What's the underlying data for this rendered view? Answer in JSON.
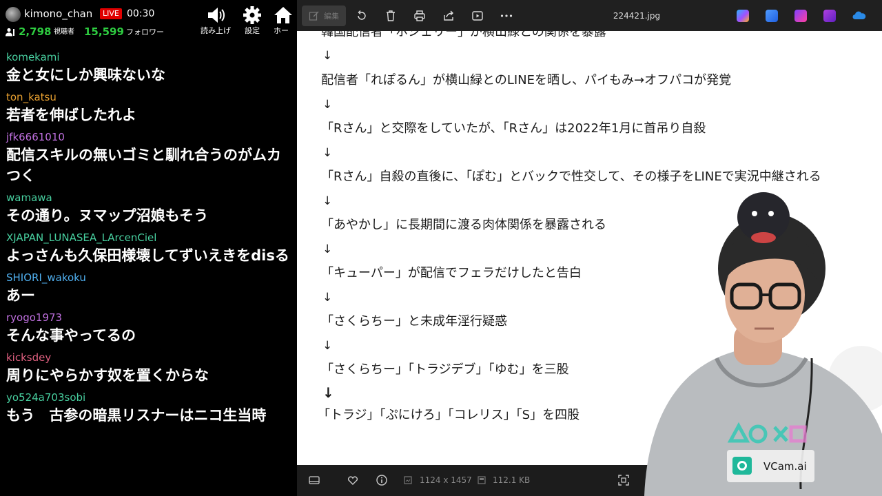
{
  "stream": {
    "username": "kimono_chan",
    "live_label": "LIVE",
    "elapsed": "00:30",
    "viewers": "2,798",
    "viewers_label": "視聴者",
    "followers": "15,599",
    "followers_label": "フォロワー",
    "buttons": [
      {
        "label": "読み上げ",
        "icon": "speaker-icon"
      },
      {
        "label": "設定",
        "icon": "gear-icon"
      },
      {
        "label": "ホー",
        "icon": "home-icon"
      }
    ]
  },
  "chat": [
    {
      "user": "komekami",
      "color": "#48d0a0",
      "text": "金と女にしか興味ないな"
    },
    {
      "user": "ton_katsu",
      "color": "#e8a030",
      "text": "若者を伸ばしたれよ"
    },
    {
      "user": "jfk6661010",
      "color": "#c070e0",
      "text": "配信スキルの無いゴミと馴れ合うのがムカつく"
    },
    {
      "user": "wamawa",
      "color": "#48d0a0",
      "text": "その通り。ヌマップ沼娘もそう"
    },
    {
      "user": "XJAPAN_LUNASEA_LArcenCiel",
      "color": "#48d0a0",
      "text": "よっさんも久保田様壊してずいえきをdisる"
    },
    {
      "user": "SHIORI_wakoku",
      "color": "#50b0f0",
      "text": "あー"
    },
    {
      "user": "ryogo1973",
      "color": "#c070e0",
      "text": "そんな事やってるの"
    },
    {
      "user": "kicksdey",
      "color": "#e06080",
      "text": "周りにやらかす奴を置くからな"
    },
    {
      "user": "yo524a703sobi",
      "color": "#48d0a0",
      "text": "もう　古参の暗黒リスナーはニコ生当時"
    }
  ],
  "viewer": {
    "edit_label": "編集",
    "filename": "224421.jpg",
    "dimensions": "1124 x 1457",
    "filesize": "112.1 KB",
    "toolbar_icons": [
      "edit-icon",
      "rotate-icon",
      "delete-icon",
      "print-icon",
      "share-icon",
      "slideshow-icon",
      "more-icon"
    ],
    "app_icons": [
      "copilot-icon",
      "photo-edit-icon",
      "clipchamp-icon",
      "app-icon",
      "onedrive-icon"
    ]
  },
  "document": {
    "lines": [
      "韓国配信者「ホシェリー」が横山緑との関係を暴露",
      "配信者「れぽるん」が横山緑とのLINEを晒し、パイもみ→オフパコが発覚",
      "「Rさん」と交際をしていたが、「Rさん」は2022年1月に首吊り自殺",
      "「Rさん」自殺の直後に、「ぽむ」とバックで性交して、その様子をLINEで実況中継される",
      "「あやかし」に長期間に渡る肉体関係を暴露される",
      "「キューパー」が配信でフェラだけしたと告白",
      "「さくらちー」と未成年淫行疑惑",
      "「さくらちー」「トラジデブ」「ゆむ」を三股",
      "「トラジ」「ぷにけろ」「コレリス」「S」を四股"
    ],
    "arrow": "↓"
  },
  "webcam": {
    "badge_label": "VCam.ai"
  }
}
